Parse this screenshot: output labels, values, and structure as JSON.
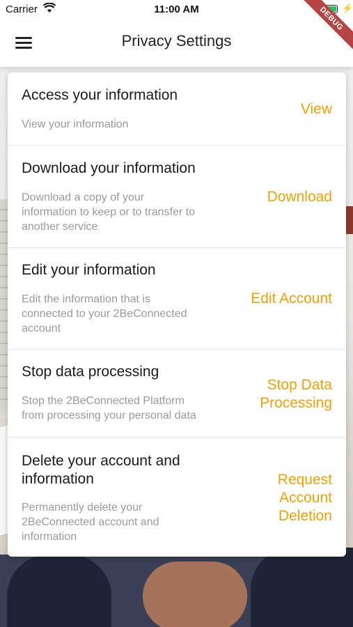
{
  "status_bar": {
    "carrier": "Carrier",
    "time": "11:00 AM",
    "icons": [
      "wifi-icon",
      "battery-icon",
      "charging-bolt-icon"
    ]
  },
  "app_bar": {
    "title": "Privacy Settings",
    "menu_icon": "hamburger-menu-icon",
    "debug_banner": "DEBUG"
  },
  "colors": {
    "accent": "#f5a000",
    "heading": "#1a1a1a",
    "description": "#9a9a9a",
    "debug": "#b54444"
  },
  "settings": [
    {
      "heading": "Access your information",
      "description": "View your information",
      "action": "View"
    },
    {
      "heading": "Download your information",
      "description": "Download a copy of your\ninformation to keep or to transfer to\nanother service",
      "action": "Download"
    },
    {
      "heading": "Edit your information",
      "description": "Edit the information that is\nconnected to your 2BeConnected\naccount",
      "action": "Edit Account"
    },
    {
      "heading": "Stop data processing",
      "description": "Stop the 2BeConnected Platform\nfrom processing your personal data",
      "action": "Stop Data\nProcessing"
    },
    {
      "heading": "Delete your account and\ninformation",
      "description": "Permanently delete your\n2BeConnected account and\ninformation",
      "action": "Request\nAccount\nDeletion"
    }
  ]
}
